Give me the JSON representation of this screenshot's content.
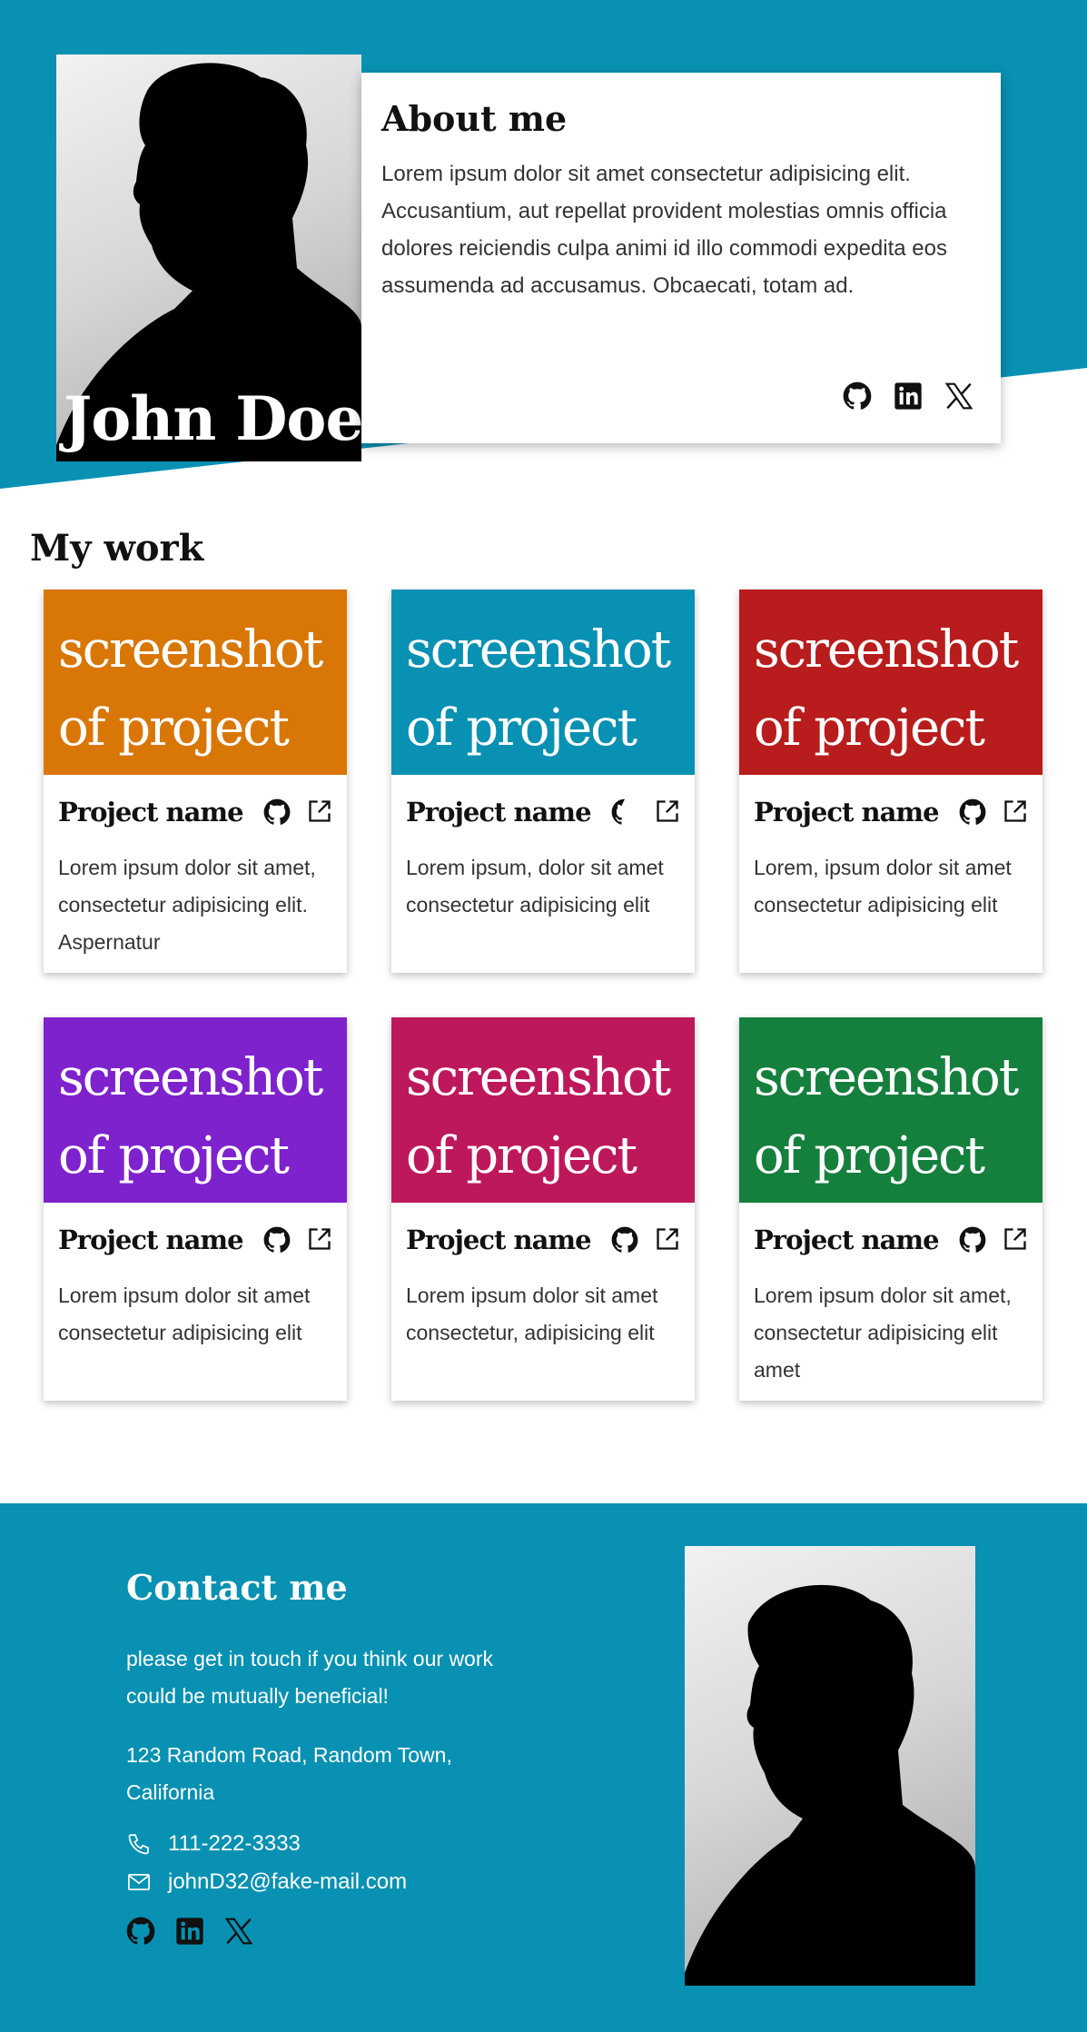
{
  "colors": {
    "accent": "#0891b2",
    "project_colors": [
      "#d97706",
      "#0891b2",
      "#b91c1c",
      "#7e22ce",
      "#be185d",
      "#15803d"
    ]
  },
  "hero": {
    "name": "John Doe",
    "about_title": "About me",
    "about_text": "Lorem ipsum dolor sit amet consectetur adipisicing elit. Accusantium, aut repellat provident molestias omnis officia dolores reiciendis culpa animi id illo commodi expedita eos assumenda ad accusamus. Obcaecati, totam ad.",
    "social_icons": [
      "github-icon",
      "linkedin-icon",
      "x-icon"
    ]
  },
  "work": {
    "title": "My work",
    "projects": [
      {
        "shot_line1": "screenshot",
        "shot_line2": "of project",
        "name": "Project name",
        "description": "Lorem ipsum dolor sit amet, consectetur adipisicing elit. Aspernatur"
      },
      {
        "shot_line1": "screenshot",
        "shot_line2": "of project",
        "name": "Project name",
        "description": "Lorem ipsum, dolor sit amet consectetur adipisicing elit"
      },
      {
        "shot_line1": "screenshot",
        "shot_line2": "of project",
        "name": "Project name",
        "description": "Lorem, ipsum dolor sit amet consectetur adipisicing elit"
      },
      {
        "shot_line1": "screenshot",
        "shot_line2": "of project",
        "name": "Project name",
        "description": "Lorem ipsum dolor sit amet consectetur adipisicing elit"
      },
      {
        "shot_line1": "screenshot",
        "shot_line2": "of project",
        "name": "Project name",
        "description": "Lorem ipsum dolor sit amet consectetur, adipisicing elit"
      },
      {
        "shot_line1": "screenshot",
        "shot_line2": "of project",
        "name": "Project name",
        "description": "Lorem ipsum dolor sit amet, consectetur adipisicing elit amet"
      }
    ]
  },
  "contact": {
    "title": "Contact me",
    "text": "please get in touch if you think our work could be mutually beneficial!",
    "address": "123 Random Road, Random Town, California",
    "phone": "111-222-3333",
    "email": "johnD32@fake-mail.com",
    "social_icons": [
      "github-icon",
      "linkedin-icon",
      "x-icon"
    ]
  }
}
